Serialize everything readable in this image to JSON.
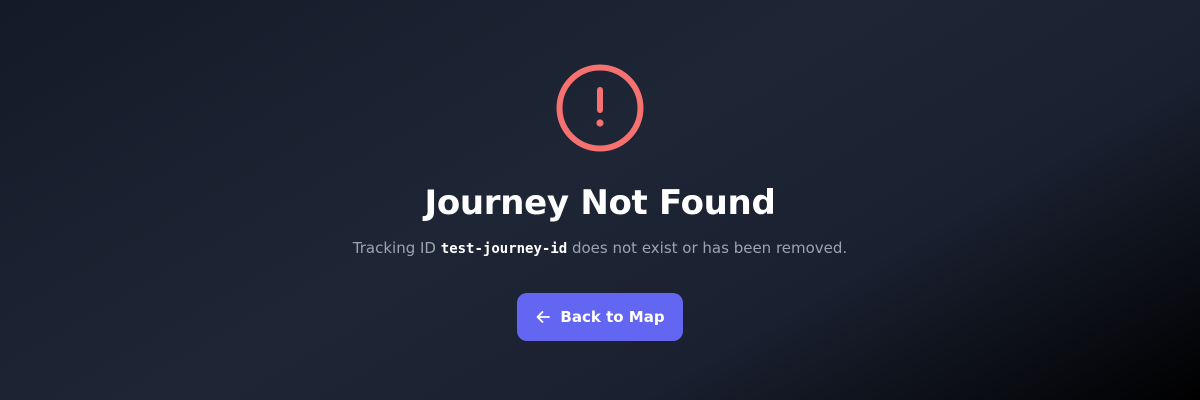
{
  "error": {
    "icon": "exclamation-circle-icon",
    "icon_color": "#f87171",
    "title": "Journey Not Found",
    "message_prefix": "Tracking ID",
    "tracking_id": "test-journey-id",
    "message_suffix": "does not exist or has been removed."
  },
  "actions": {
    "back_label": "Back to Map",
    "back_icon": "arrow-left-icon",
    "accent_color": "#6366f1"
  }
}
